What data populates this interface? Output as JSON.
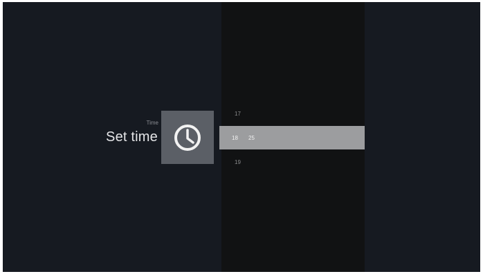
{
  "header": {
    "category": "Time",
    "title": "Set time"
  },
  "icon": {
    "name": "clock-icon",
    "tile_color": "#5b5f66"
  },
  "time_picker": {
    "hour_previous": "17",
    "hour_selected": "18",
    "minute_selected": "25",
    "hour_next": "19"
  },
  "colors": {
    "background": "#161a21",
    "picker_column": "#111213",
    "selected_row": "#9c9d9f"
  }
}
